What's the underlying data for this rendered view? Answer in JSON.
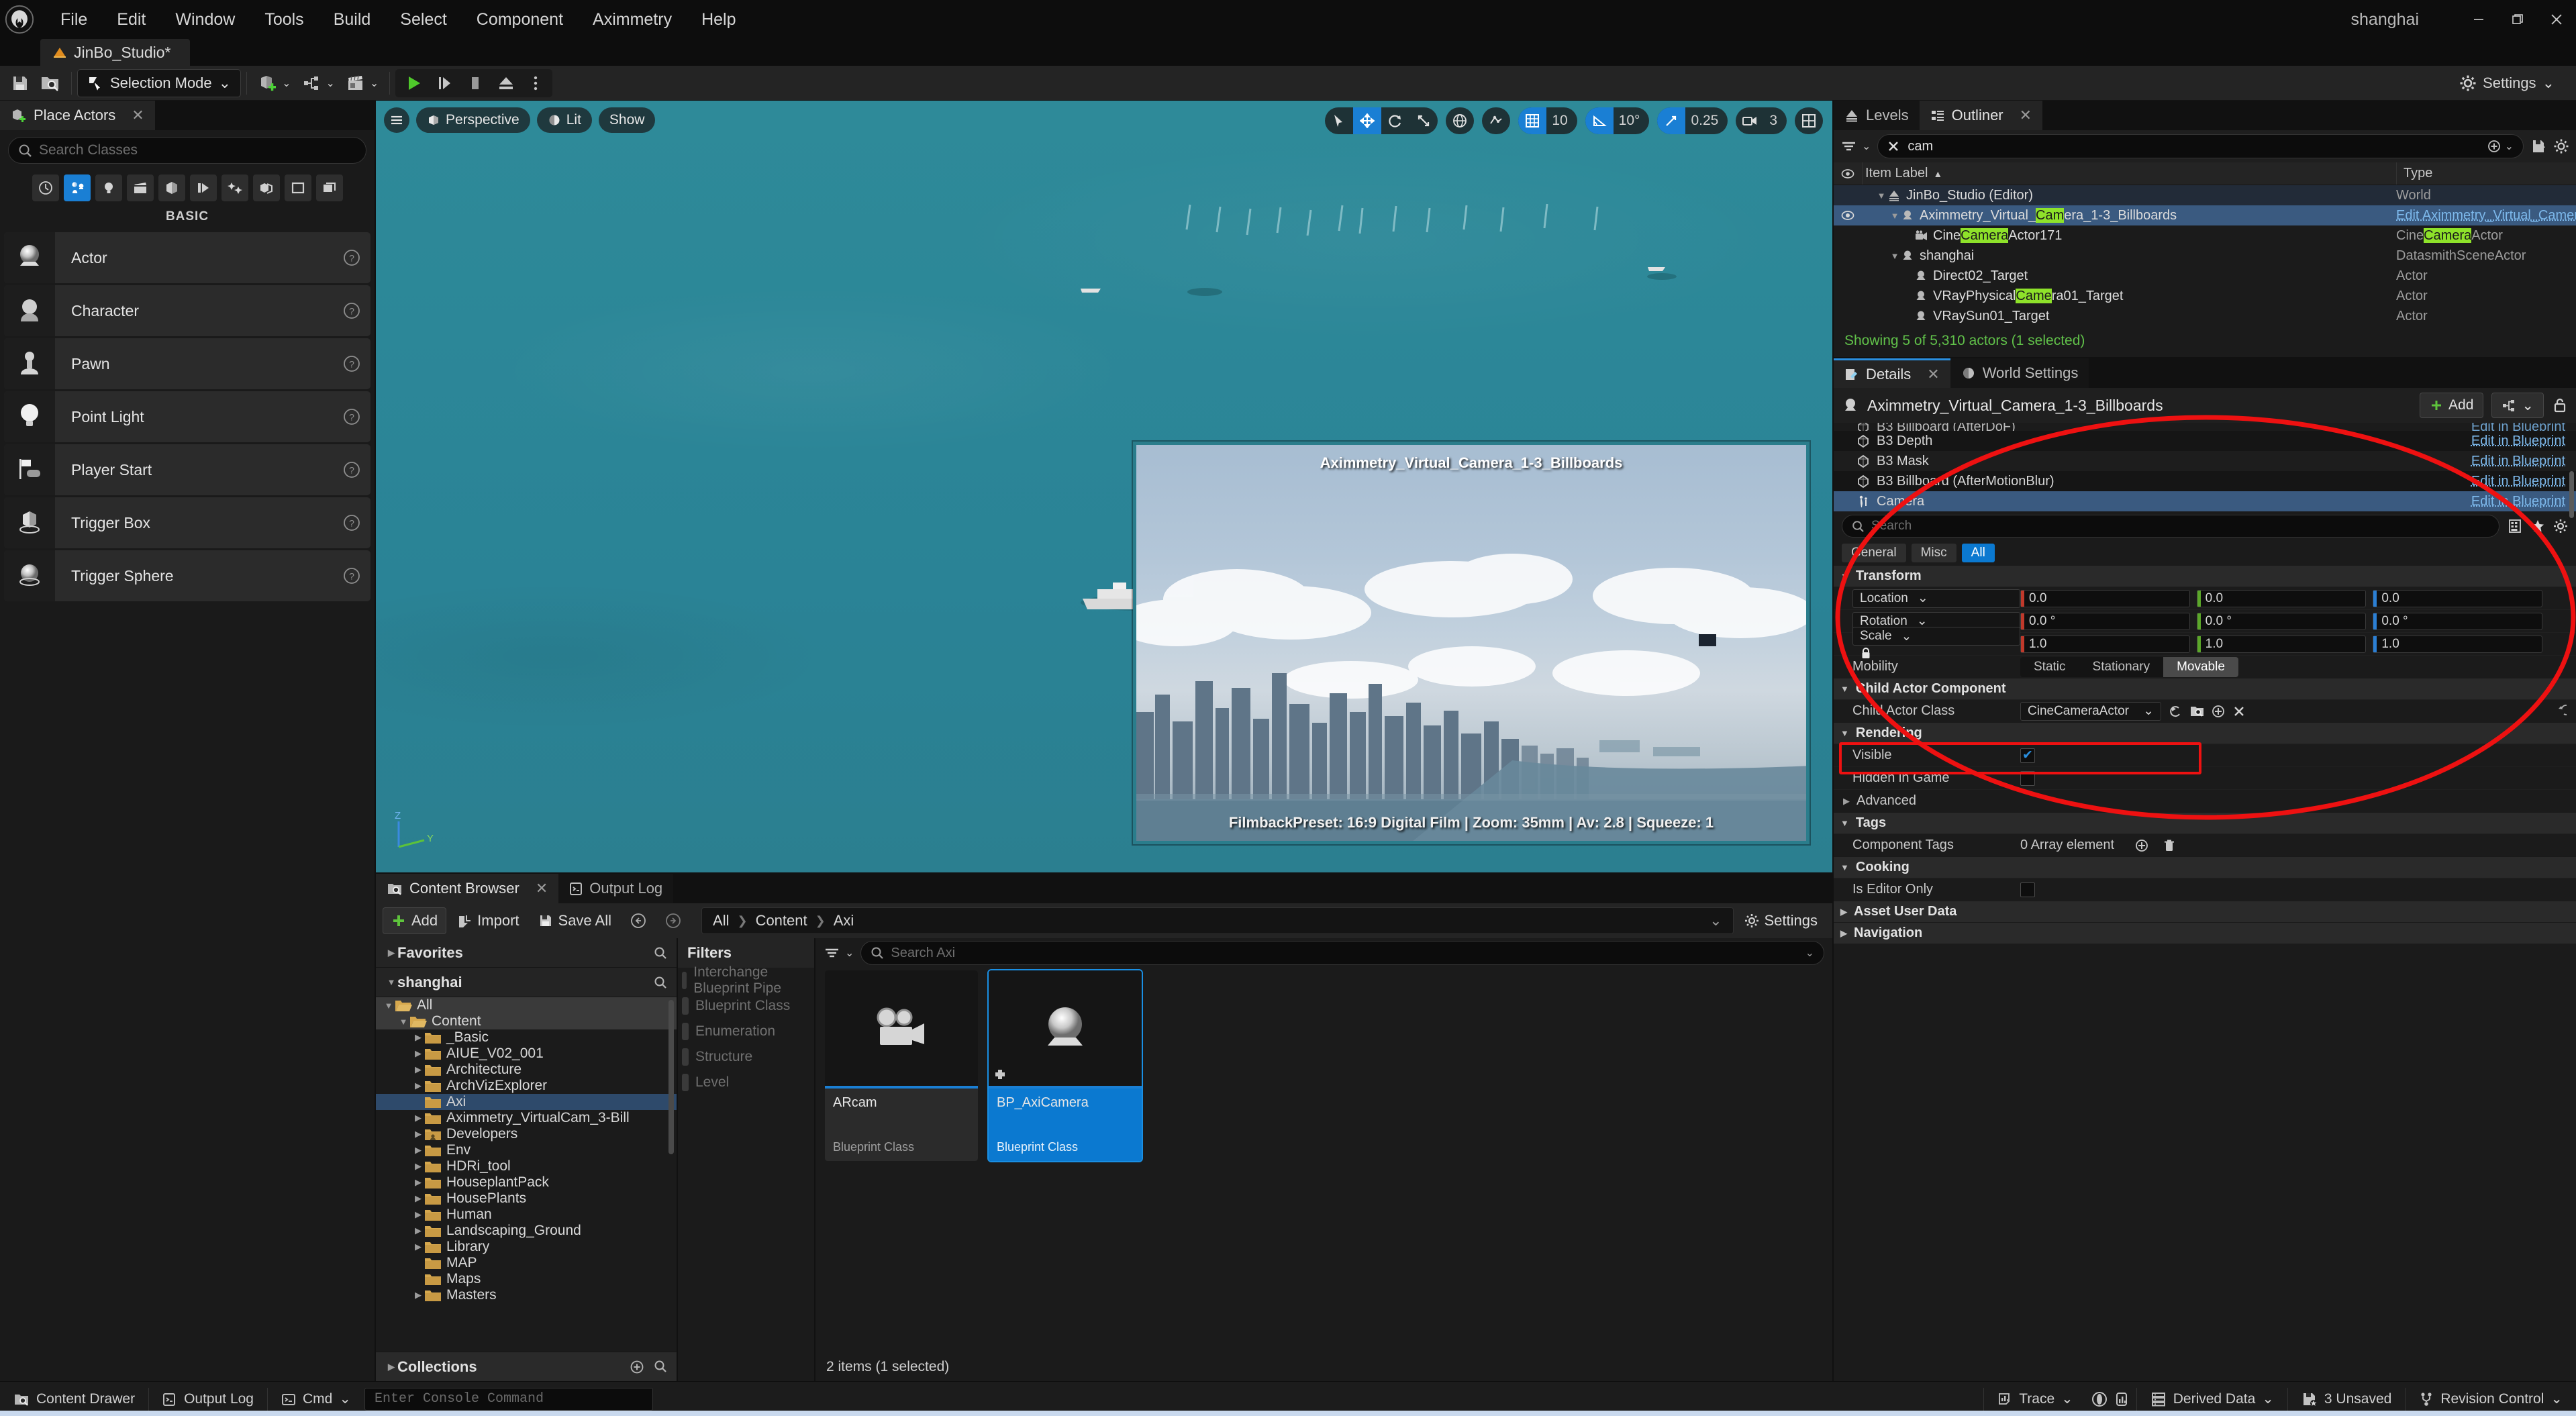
{
  "window": {
    "project_name": "shanghai",
    "minimize": "–",
    "maximize": "❐",
    "close": "✕"
  },
  "menubar": {
    "items": [
      "File",
      "Edit",
      "Window",
      "Tools",
      "Build",
      "Select",
      "Component",
      "Aximmetry",
      "Help"
    ]
  },
  "level_tab": {
    "label": "JinBo_Studio*"
  },
  "toolbar": {
    "mode_label": "Selection Mode",
    "settings_label": "Settings"
  },
  "place_actors": {
    "tab_label": "Place Actors",
    "search_placeholder": "Search Classes",
    "category_label": "BASIC",
    "categories": [
      "recent-icon",
      "basic-icon",
      "lights-icon",
      "cinematic-icon",
      "shapes-icon",
      "visual-effects-icon",
      "volumes-icon",
      "all-classes-icon",
      "geometry-icon",
      "layers-icon"
    ],
    "items": [
      {
        "label": "Actor",
        "icon": "actor-sphere-icon"
      },
      {
        "label": "Character",
        "icon": "character-icon"
      },
      {
        "label": "Pawn",
        "icon": "pawn-icon"
      },
      {
        "label": "Point Light",
        "icon": "point-light-icon"
      },
      {
        "label": "Player Start",
        "icon": "player-start-icon"
      },
      {
        "label": "Trigger Box",
        "icon": "trigger-box-icon"
      },
      {
        "label": "Trigger Sphere",
        "icon": "trigger-sphere-icon"
      }
    ]
  },
  "viewport": {
    "perspective_label": "Perspective",
    "lit_label": "Lit",
    "show_label": "Show",
    "grid_snap_value": "10",
    "angle_snap_value": "10°",
    "scale_snap_value": "0.25",
    "camera_speed_value": "3",
    "gizmo_axes": [
      "Z",
      "Y"
    ],
    "pip": {
      "title": "Aximmetry_Virtual_Camera_1-3_Billboards",
      "info": "FilmbackPreset: 16:9 Digital Film | Zoom: 35mm | Av: 2.8 | Squeeze: 1"
    }
  },
  "outliner": {
    "tabs": [
      {
        "label": "Levels",
        "active": false,
        "closable": false
      },
      {
        "label": "Outliner",
        "active": true,
        "closable": true
      }
    ],
    "search_value": "cam",
    "columns": [
      "Item Label",
      "Type"
    ],
    "sort_indicator": "▲",
    "rows": [
      {
        "label": "JinBo_Studio (Editor)",
        "type": "World",
        "depth": 1,
        "expandable": true,
        "icon": "world-icon",
        "state": "world"
      },
      {
        "label_pre": "Aximmetry_Virtual_",
        "label_hl": "Cam",
        "label_post": "era_1-3_Billboards",
        "type": "Edit Aximmetry_Virtual_Camera_",
        "type_link": true,
        "depth": 2,
        "expandable": true,
        "icon": "actor-icon",
        "state": "selected",
        "eye": true
      },
      {
        "label_pre": "Cine",
        "label_hl": "Camera",
        "label_post": "Actor171",
        "type_pre": "Cine",
        "type_hl": "Camera",
        "type_post": "Actor",
        "depth": 3,
        "icon": "cine-camera-icon",
        "state": ""
      },
      {
        "label": "shanghai",
        "type": "DatasmithSceneActor",
        "depth": 2,
        "expandable": true,
        "icon": "actor-icon",
        "state": ""
      },
      {
        "label": "Direct02_Target",
        "type": "Actor",
        "depth": 3,
        "icon": "actor-icon",
        "state": ""
      },
      {
        "label_pre": "VRayPhysical",
        "label_hl": "Came",
        "label_post": "ra01_Target",
        "type": "Actor",
        "depth": 3,
        "icon": "actor-icon",
        "state": ""
      },
      {
        "label": "VRaySun01_Target",
        "type": "Actor",
        "depth": 3,
        "icon": "actor-icon",
        "state": ""
      }
    ],
    "status": "Showing 5 of 5,310 actors (1 selected)"
  },
  "details": {
    "tabs": [
      {
        "label": "Details",
        "active": true,
        "closable": true
      },
      {
        "label": "World Settings",
        "active": false,
        "closable": false
      }
    ],
    "actor_title": "Aximmetry_Virtual_Camera_1-3_Billboards",
    "add_label": "Add",
    "components": [
      {
        "label": "B3 Billboard (AfterDoF)",
        "action": "Edit in Blueprint",
        "clipped": true
      },
      {
        "label": "B3 Depth",
        "action": "Edit in Blueprint"
      },
      {
        "label": "B3 Mask",
        "action": "Edit in Blueprint"
      },
      {
        "label": "B3 Billboard (AfterMotionBlur)",
        "action": "Edit in Blueprint"
      },
      {
        "label": "Camera",
        "action": "Edit in Blueprint",
        "selected": true
      }
    ],
    "search_placeholder": "Search",
    "chips": [
      {
        "label": "General",
        "active": false
      },
      {
        "label": "Misc",
        "active": false
      },
      {
        "label": "All",
        "active": true
      }
    ],
    "sections": [
      {
        "name": "Transform",
        "expanded": true,
        "rows": [
          {
            "kind": "vector",
            "label": "Location",
            "values": [
              "0.0",
              "0.0",
              "0.0"
            ]
          },
          {
            "kind": "vector",
            "label": "Rotation",
            "values": [
              "0.0 °",
              "0.0 °",
              "0.0 °"
            ]
          },
          {
            "kind": "vector",
            "label": "Scale",
            "values": [
              "1.0",
              "1.0",
              "1.0"
            ],
            "lock": true
          },
          {
            "kind": "mobility",
            "label": "Mobility",
            "options": [
              "Static",
              "Stationary",
              "Movable"
            ],
            "selected": "Movable"
          }
        ]
      },
      {
        "name": "Child Actor Component",
        "expanded": true,
        "rows": [
          {
            "kind": "class",
            "label": "Child Actor Class",
            "value": "CineCameraActor"
          }
        ]
      },
      {
        "name": "Rendering",
        "expanded": true,
        "rows": [
          {
            "kind": "checkbox",
            "label": "Visible",
            "checked": true
          },
          {
            "kind": "checkbox",
            "label": "Hidden in Game",
            "checked": false
          },
          {
            "kind": "subsection",
            "label": "Advanced"
          }
        ]
      },
      {
        "name": "Tags",
        "expanded": true,
        "rows": [
          {
            "kind": "array",
            "label": "Component Tags",
            "value": "0 Array element"
          }
        ]
      },
      {
        "name": "Cooking",
        "expanded": true,
        "rows": [
          {
            "kind": "checkbox",
            "label": "Is Editor Only",
            "checked": false
          }
        ]
      },
      {
        "name": "Asset User Data",
        "expanded": false,
        "rows": []
      },
      {
        "name": "Navigation",
        "expanded": false,
        "rows": []
      }
    ]
  },
  "content_browser": {
    "tabs": [
      {
        "label": "Content Browser",
        "active": true,
        "closable": true
      },
      {
        "label": "Output Log",
        "active": false,
        "closable": false
      }
    ],
    "buttons": {
      "add": "Add",
      "import": "Import",
      "save_all": "Save All"
    },
    "breadcrumb": [
      "All",
      "Content",
      "Axi"
    ],
    "settings_label": "Settings",
    "favorites_label": "Favorites",
    "root_label": "shanghai",
    "collections_label": "Collections",
    "filters_label": "Filters",
    "filters": [
      "Interchange Blueprint Pipe",
      "Blueprint Class",
      "Enumeration",
      "Structure",
      "Level"
    ],
    "tree": [
      {
        "label": "All",
        "depth": 0,
        "expanded": true,
        "state": "hl"
      },
      {
        "label": "Content",
        "depth": 1,
        "expanded": true,
        "state": "hl"
      },
      {
        "label": "_Basic",
        "depth": 2,
        "expandable": true
      },
      {
        "label": "AIUE_V02_001",
        "depth": 2,
        "expandable": true
      },
      {
        "label": "Architecture",
        "depth": 2,
        "expandable": true
      },
      {
        "label": "ArchVizExplorer",
        "depth": 2,
        "expandable": true
      },
      {
        "label": "Axi",
        "depth": 2,
        "state": "sel"
      },
      {
        "label": "Aximmetry_VirtualCam_3-Bill",
        "depth": 2,
        "expandable": true
      },
      {
        "label": "Developers",
        "depth": 2,
        "expandable": true,
        "icon": "developers-folder-icon"
      },
      {
        "label": "Env",
        "depth": 2,
        "expandable": true
      },
      {
        "label": "HDRi_tool",
        "depth": 2,
        "expandable": true
      },
      {
        "label": "HouseplantPack",
        "depth": 2,
        "expandable": true
      },
      {
        "label": "HousePlants",
        "depth": 2,
        "expandable": true
      },
      {
        "label": "Human",
        "depth": 2,
        "expandable": true
      },
      {
        "label": "Landscaping_Ground",
        "depth": 2,
        "expandable": true
      },
      {
        "label": "Library",
        "depth": 2,
        "expandable": true
      },
      {
        "label": "MAP",
        "depth": 2
      },
      {
        "label": "Maps",
        "depth": 2
      },
      {
        "label": "Masters",
        "depth": 2,
        "expandable": true
      }
    ],
    "assets_search_placeholder": "Search Axi",
    "assets": [
      {
        "name": "ARcam",
        "type": "Blueprint Class",
        "icon": "movie-camera-icon",
        "selected": false
      },
      {
        "name": "BP_AxiCamera",
        "type": "Blueprint Class",
        "icon": "actor-sphere-icon",
        "selected": true
      }
    ],
    "status": "2 items (1 selected)"
  },
  "statusbar": {
    "left": [
      {
        "label": "Content Drawer",
        "icon": "drawer-icon"
      },
      {
        "label": "Output Log",
        "icon": "log-icon"
      },
      {
        "label": "Cmd",
        "icon": "cmd-icon"
      }
    ],
    "console_placeholder": "Enter Console Command",
    "right": [
      {
        "label": "Trace",
        "icon": "trace-icon"
      },
      {
        "label": "Derived Data",
        "icon": "derived-data-icon"
      },
      {
        "label": "3 Unsaved",
        "icon": "unsaved-icon"
      },
      {
        "label": "Revision Control",
        "icon": "revision-control-icon"
      }
    ]
  },
  "colors": {
    "accent_blue": "#0b79d0",
    "highlight_green": "#8ee22a",
    "status_green": "#61c24a",
    "annotation_red": "#ee1111",
    "selection_blue": "#3a5a80"
  }
}
